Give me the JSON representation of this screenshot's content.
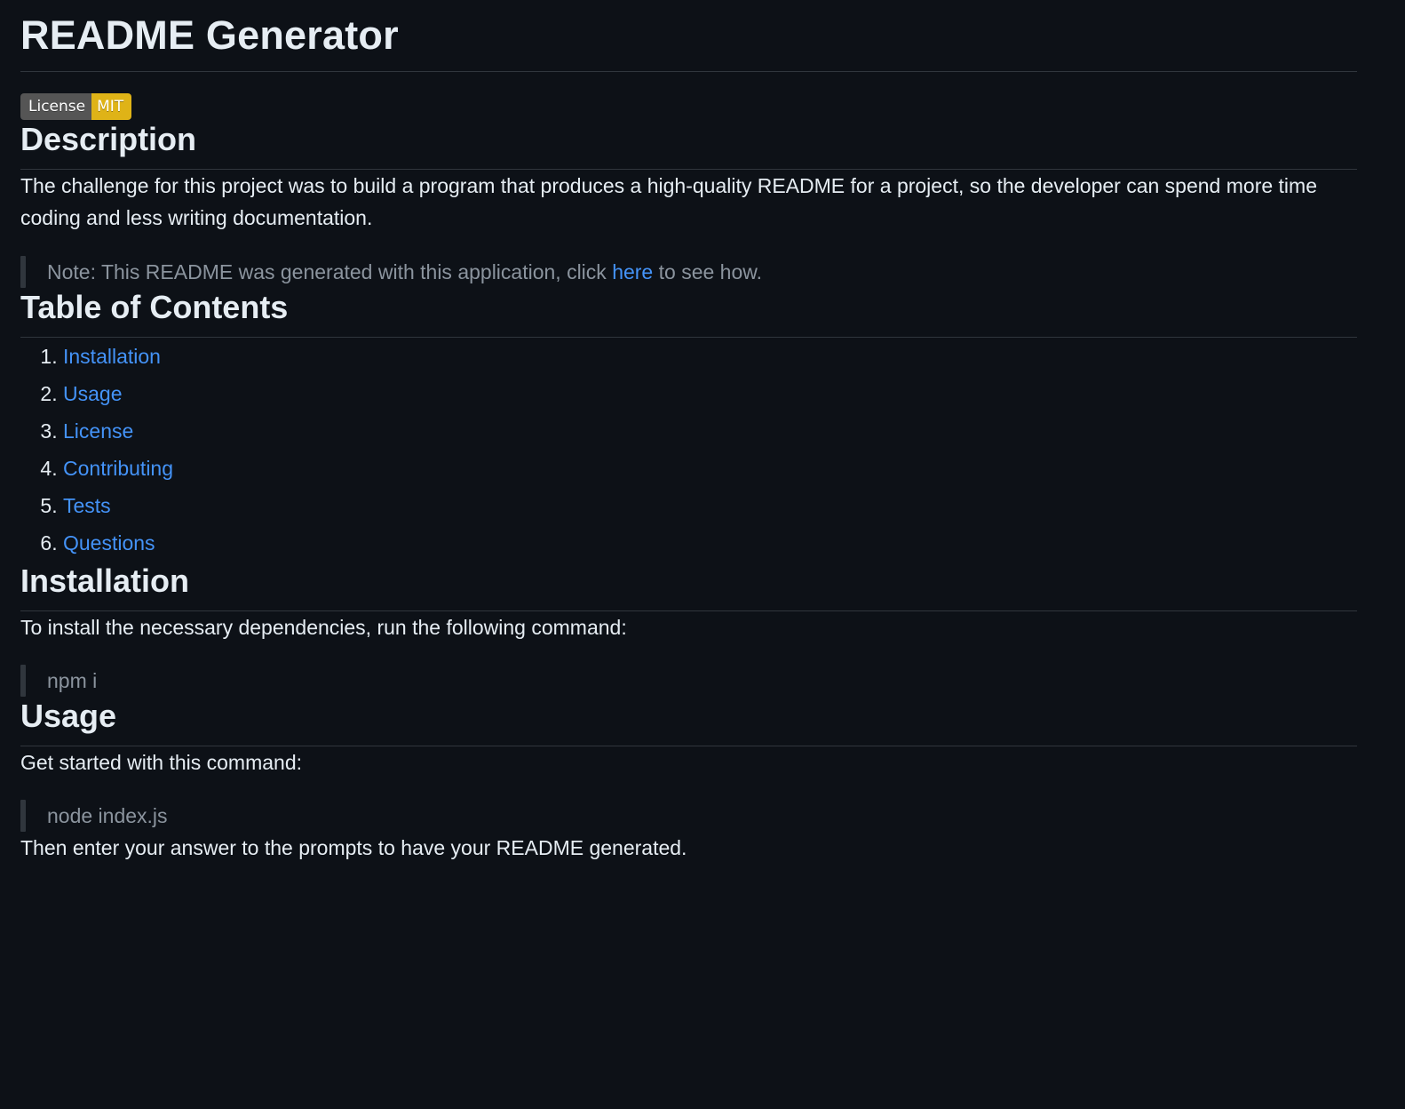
{
  "readme": {
    "title": "README Generator",
    "badge": {
      "label": "License",
      "value": "MIT",
      "label_color": "#555555",
      "value_color": "#dfb317"
    },
    "description": {
      "heading": "Description",
      "text": "The challenge for this project was to build a program that produces a high-quality README for a project, so the developer can spend more time coding and less writing documentation.",
      "note_prefix": "Note: This README was generated with this application, click ",
      "note_link": "here",
      "note_suffix": " to see how."
    },
    "toc": {
      "heading": "Table of Contents",
      "items": [
        "Installation",
        "Usage",
        "License",
        "Contributing",
        "Tests",
        "Questions"
      ]
    },
    "installation": {
      "heading": "Installation",
      "text": "To install the necessary dependencies, run the following command:",
      "command": "npm i"
    },
    "usage": {
      "heading": "Usage",
      "text": "Get started with this command:",
      "command": "node index.js",
      "followup": "Then enter your answer to the prompts to have your README generated."
    }
  },
  "theme": {
    "background": "#0d1117",
    "text": "#e6edf3",
    "muted": "#8b949e",
    "link": "#4493f8",
    "border": "#30363d"
  }
}
